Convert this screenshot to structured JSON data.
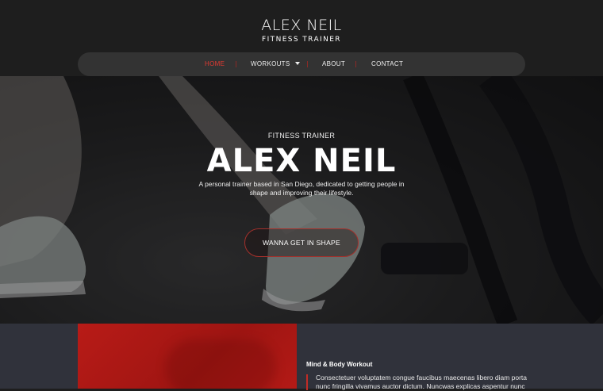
{
  "brand": {
    "name": "ALEX NEIL",
    "subtitle": "FITNESS TRAINER"
  },
  "nav": {
    "items": [
      {
        "label": "HOME",
        "active": true
      },
      {
        "label": "WORKOUTS",
        "has_dropdown": true
      },
      {
        "label": "ABOUT"
      },
      {
        "label": "CONTACT"
      }
    ],
    "colors": {
      "active": "#e03a32",
      "pill": "#333333"
    }
  },
  "hero": {
    "kicker": "FITNESS TRAINER",
    "title": "ALEX NEIL",
    "description": "A personal trainer based in San Diego, dedicated to getting people in shape and improving their lifestyle.",
    "cta_label": "WANNA GET IN SHAPE",
    "cta_border_color": "#a3302b"
  },
  "feature": {
    "title": "Mind & Body Workout",
    "text": "Consectetuer voluptatem congue faucibus maecenas libero diam porta nunc fringilla vivamus auctor dictum. Nuncwas explicas aspentur nunc",
    "image_color": "#b81b17"
  }
}
